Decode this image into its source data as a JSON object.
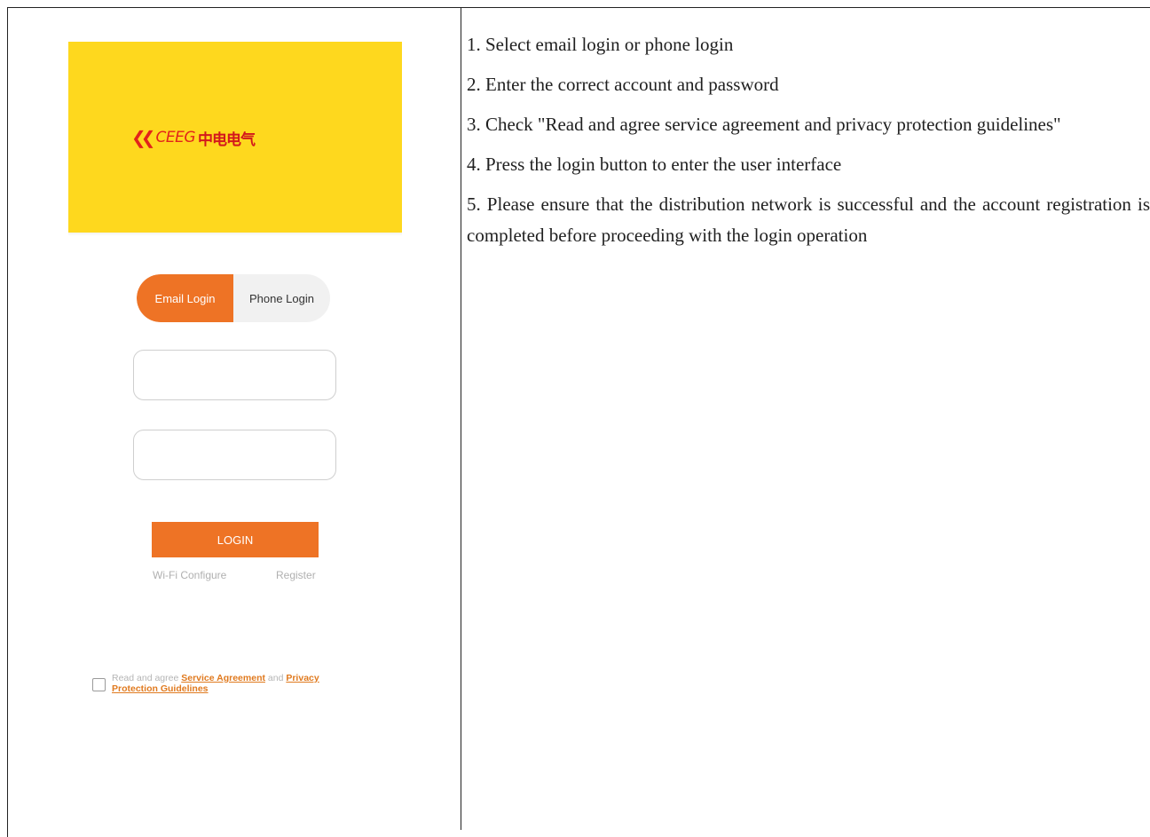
{
  "app": {
    "logo_en": "CEEG",
    "logo_cn": "中电电气",
    "tabs": [
      "Email Login",
      "Phone Login"
    ],
    "active_tab": "Email Login",
    "email_field": {
      "value": "",
      "placeholder": ""
    },
    "password_field": {
      "value": "",
      "placeholder": ""
    },
    "login_button": "LOGIN",
    "wifi_link": "Wi-Fi Configure",
    "register_link": "Register",
    "agreement": {
      "prefix": "Read and agree ",
      "service": "Service Agreement",
      "and": " and ",
      "privacy": "Privacy Protection Guidelines",
      "checked": false
    }
  },
  "instructions": [
    "1. Select email login or phone login",
    "2. Enter the correct account and password",
    "3. Check \"Read and agree service agreement and privacy protection guidelines\"",
    "4. Press the login button to enter the user interface",
    "5. Please ensure that the distribution network is successful and the account registration is completed before proceeding with the login operation"
  ],
  "colors": {
    "banner": "#fed81e",
    "accent": "#ee7325",
    "logo_red": "#e2231a",
    "link_orange": "#e07a1f"
  }
}
